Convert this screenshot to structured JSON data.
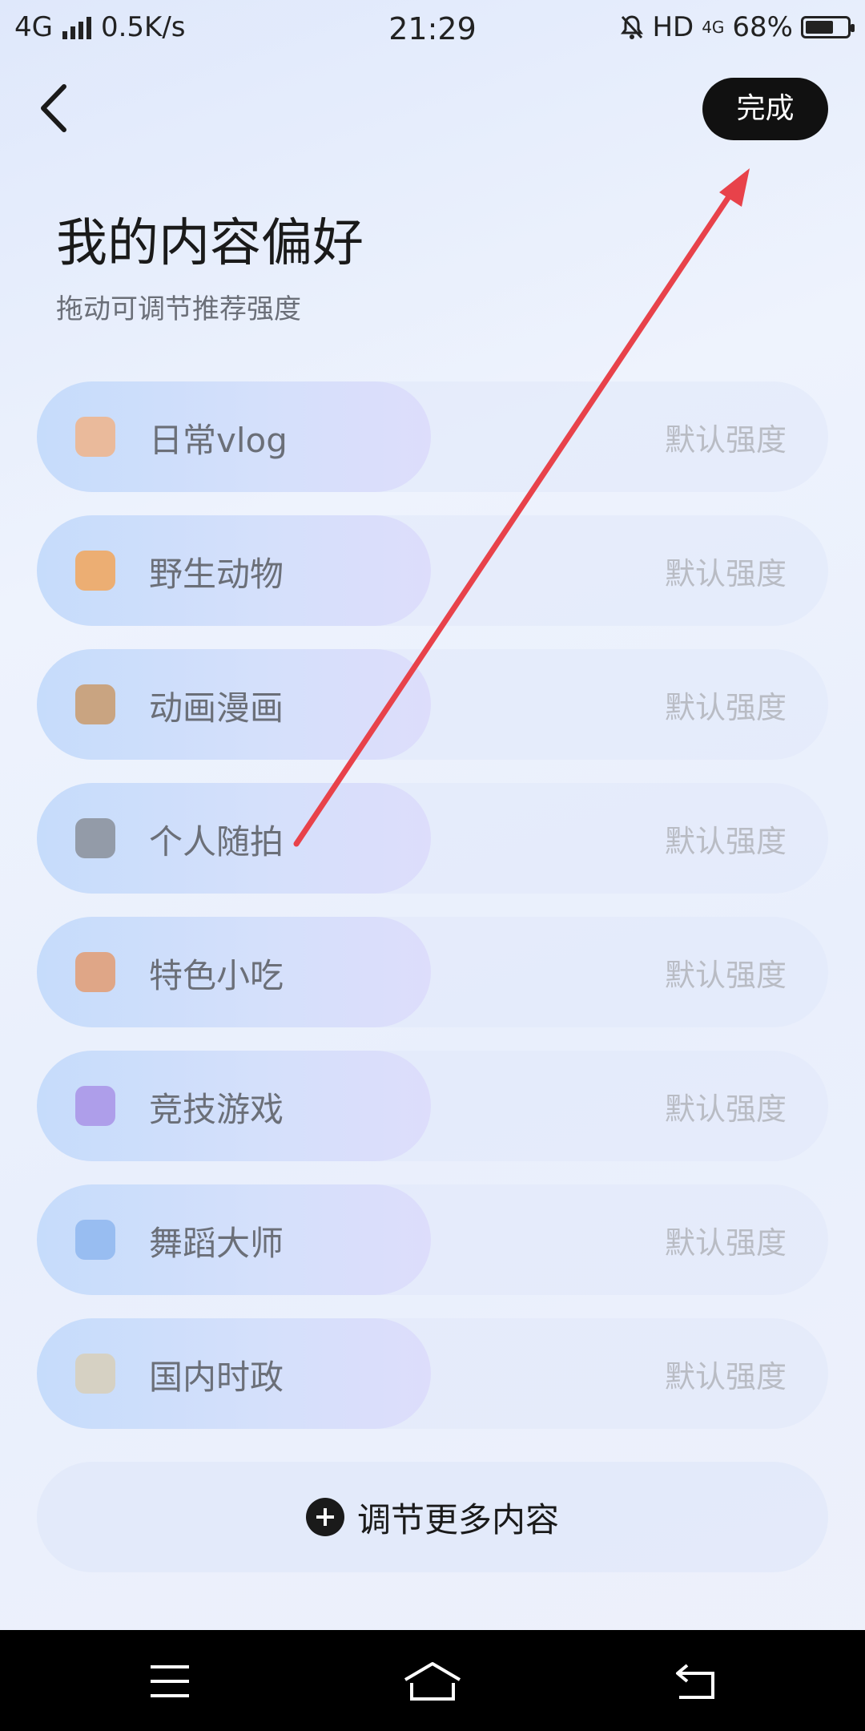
{
  "status_bar": {
    "network": "4G",
    "speed": "0.5K/s",
    "time": "21:29",
    "hd": "HD",
    "net_small": "4G",
    "battery": "68%",
    "battery_level": 0.68
  },
  "header": {
    "done_label": "完成",
    "title": "我的内容偏好",
    "subtitle": "拖动可调节推荐强度"
  },
  "preferences": [
    {
      "name": "日常vlog",
      "level": "默认强度",
      "icon": "phone-vlog-icon",
      "color": "#f0b48a"
    },
    {
      "name": "野生动物",
      "level": "默认强度",
      "icon": "tiger-icon",
      "color": "#f2a65a"
    },
    {
      "name": "动画漫画",
      "level": "默认强度",
      "icon": "bear-icon",
      "color": "#c99a6b"
    },
    {
      "name": "个人随拍",
      "level": "默认强度",
      "icon": "camera-icon",
      "color": "#8a8f99"
    },
    {
      "name": "特色小吃",
      "level": "默认强度",
      "icon": "food-stall-icon",
      "color": "#e39c72"
    },
    {
      "name": "竞技游戏",
      "level": "默认强度",
      "icon": "gem-shield-icon",
      "color": "#a993e6"
    },
    {
      "name": "舞蹈大师",
      "level": "默认强度",
      "icon": "dancer-icon",
      "color": "#8fb7ee"
    },
    {
      "name": "国内时政",
      "level": "默认强度",
      "icon": "newspaper-icon",
      "color": "#d8cfb8"
    }
  ],
  "more": {
    "label": "调节更多内容"
  },
  "colors": {
    "accent_dark": "#111111",
    "arrow": "#e8424a",
    "pill": "#c6dcfb"
  }
}
